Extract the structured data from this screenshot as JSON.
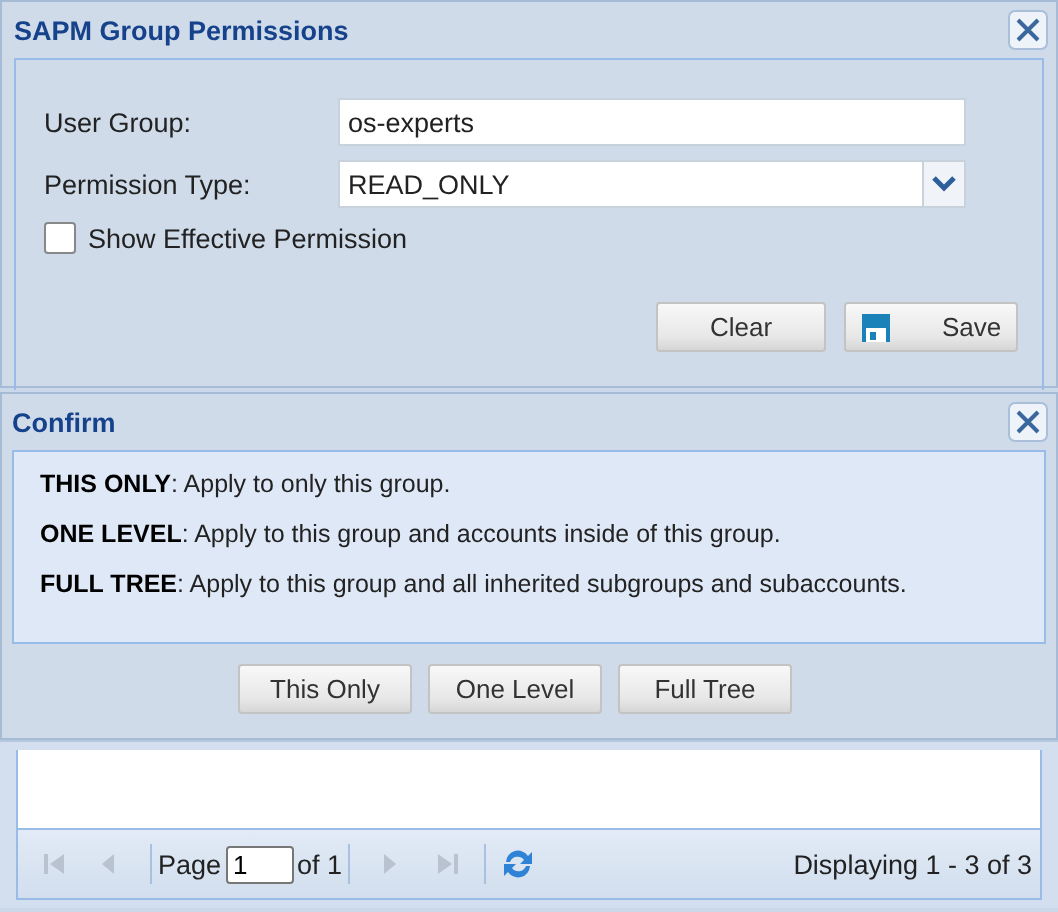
{
  "permissions_window": {
    "title": "SAPM Group Permissions",
    "fields": [
      {
        "kind": "text",
        "label": "User Group:",
        "value": "os-experts"
      },
      {
        "kind": "select",
        "label": "Permission Type:",
        "value": "READ_ONLY"
      }
    ],
    "checkbox": {
      "label": "Show Effective Permission",
      "checked": false
    },
    "buttons": [
      {
        "kind": "plain",
        "label": "Clear"
      },
      {
        "kind": "save",
        "label": "Save"
      }
    ]
  },
  "confirm_dialog": {
    "title": "Confirm",
    "messages": [
      "**THIS ONLY**: Apply to only this group.",
      "**ONE LEVEL**: Apply to this group and accounts inside of this group.",
      "**FULL TREE**: Apply to this group and all inherited subgroups and subaccounts."
    ],
    "buttons": [
      "This Only",
      "One Level",
      "Full Tree"
    ]
  },
  "pager": {
    "first_disabled": true,
    "prev_disabled": true,
    "page_label": "Page",
    "page_value": "1",
    "of_label": "of 1",
    "next_disabled": true,
    "last_disabled": true,
    "status": "Displaying 1 - 3 of 3"
  }
}
